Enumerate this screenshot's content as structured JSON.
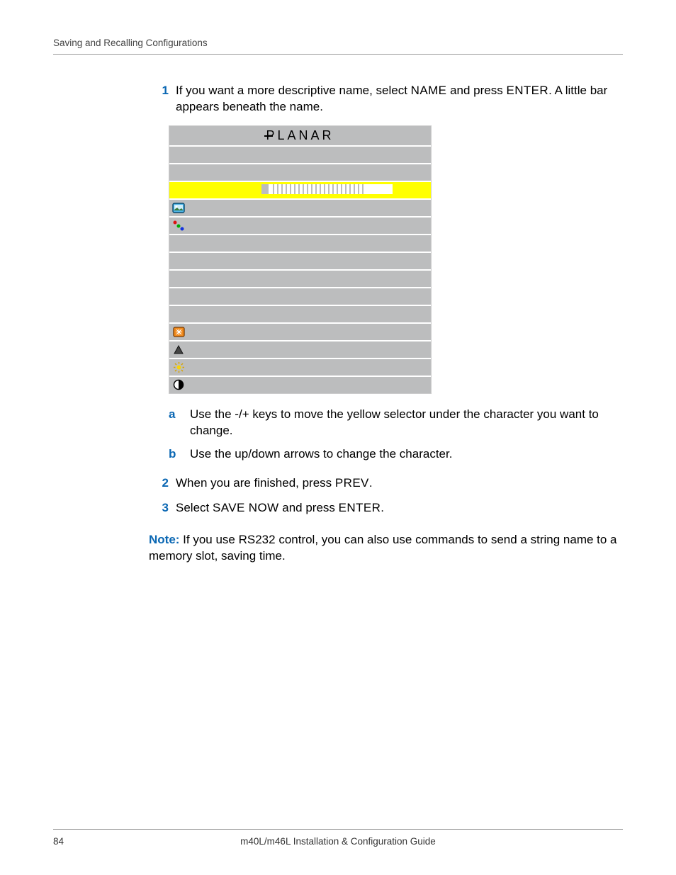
{
  "header": {
    "section_title": "Saving and Recalling Configurations"
  },
  "steps": {
    "s1_marker": "1",
    "s1a": "If you want a more descriptive name, select ",
    "s1_name": "NAME",
    "s1b": " and press ",
    "s1_enter": "ENTER",
    "s1c": ". A little bar appears beneath the name.",
    "sub_a_marker": "a",
    "sub_a_text": "Use the -/+ keys to move the yellow selector under the character you want to change.",
    "sub_b_marker": "b",
    "sub_b_text": "Use the up/down arrows to change the character.",
    "s2_marker": "2",
    "s2a": "When you are finished, press ",
    "s2_prev": "PREV",
    "s2b": ".",
    "s3_marker": "3",
    "s3a": "Select ",
    "s3_save": "SAVE NOW",
    "s3b": " and press ",
    "s3_enter": "ENTER",
    "s3c": "."
  },
  "figure": {
    "brand": "PLANAR"
  },
  "note": {
    "label": "Note:",
    "text": " If you use RS232 control, you can also use commands to send a string name to a memory slot, saving time."
  },
  "footer": {
    "page_number": "84",
    "doc_title": "m40L/m46L Installation & Configuration Guide"
  }
}
